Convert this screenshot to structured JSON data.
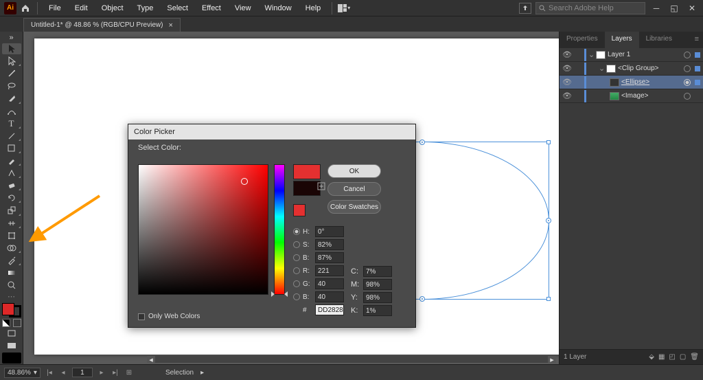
{
  "menubar": {
    "items": [
      "File",
      "Edit",
      "Object",
      "Type",
      "Select",
      "Effect",
      "View",
      "Window",
      "Help"
    ],
    "search_placeholder": "Search Adobe Help"
  },
  "document": {
    "tab_title": "Untitled-1* @ 48.86 % (RGB/CPU Preview)"
  },
  "panel": {
    "tabs": [
      "Properties",
      "Layers",
      "Libraries"
    ],
    "active_tab": 1,
    "layers": [
      {
        "indent": 0,
        "name": "Layer 1",
        "expanded": true,
        "selected": false,
        "has_square": true
      },
      {
        "indent": 1,
        "name": "<Clip Group>",
        "expanded": true,
        "selected": false,
        "has_square": true
      },
      {
        "indent": 2,
        "name": "<Ellipse>",
        "expanded": false,
        "selected": true,
        "has_square": true,
        "circ_fill": true
      },
      {
        "indent": 2,
        "name": "<Image>",
        "expanded": false,
        "selected": false,
        "has_square": false
      }
    ],
    "footer_label": "1 Layer"
  },
  "dialog": {
    "title": "Color Picker",
    "select_label": "Select Color:",
    "buttons": {
      "ok": "OK",
      "cancel": "Cancel",
      "swatches": "Color Swatches"
    },
    "hsl": {
      "h_label": "H:",
      "s_label": "S:",
      "b_label": "B:",
      "h": "0°",
      "s": "82%",
      "b": "87%"
    },
    "rgb": {
      "r_label": "R:",
      "g_label": "G:",
      "b_label": "B:",
      "r": "221",
      "g": "40",
      "b": "40"
    },
    "cmyk": {
      "c_label": "C:",
      "m_label": "M:",
      "y_label": "Y:",
      "k_label": "K:",
      "c": "7%",
      "m": "98%",
      "y": "98%",
      "k": "1%"
    },
    "hex_label": "#",
    "hex": "DD2828",
    "only_web": "Only Web Colors"
  },
  "status": {
    "zoom": "48.86%",
    "page": "1",
    "tool": "Selection"
  }
}
